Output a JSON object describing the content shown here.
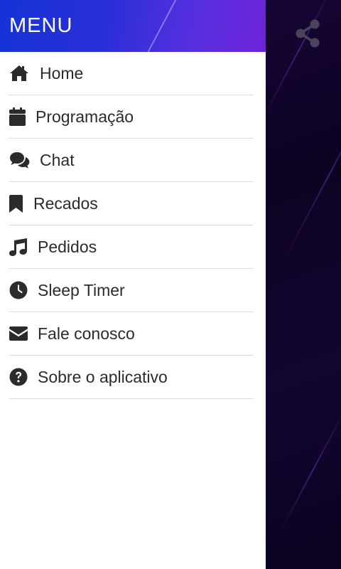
{
  "drawer": {
    "title": "MENU",
    "items": [
      {
        "label": "Home",
        "icon": "home-icon"
      },
      {
        "label": "Programação",
        "icon": "calendar-icon"
      },
      {
        "label": "Chat",
        "icon": "chat-icon"
      },
      {
        "label": "Recados",
        "icon": "bookmark-icon"
      },
      {
        "label": "Pedidos",
        "icon": "music-icon"
      },
      {
        "label": "Sleep Timer",
        "icon": "clock-icon"
      },
      {
        "label": "Fale conosco",
        "icon": "envelope-icon"
      },
      {
        "label": "Sobre o aplicativo",
        "icon": "question-circle-icon"
      }
    ]
  },
  "toolbar": {
    "share_icon": "share-icon"
  },
  "colors": {
    "header_gradient_start": "#1533d6",
    "header_gradient_end": "#6d24d6",
    "icon_color": "#2b2b2b",
    "text_color": "#2b2b2b",
    "divider_color": "#dcdcdc",
    "background_dark": "#0d0322"
  }
}
